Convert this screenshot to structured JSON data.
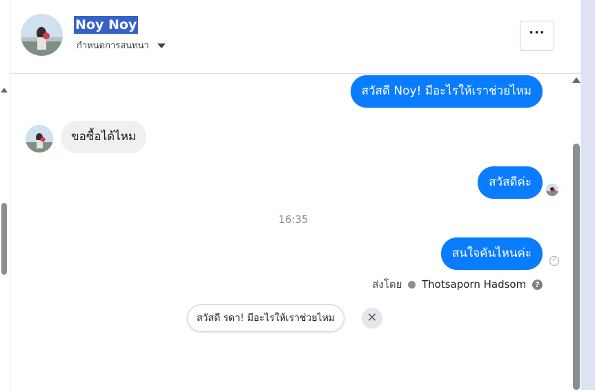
{
  "header": {
    "contact_name": "Noy Noy",
    "assign_label": "กำหนดการสนทนา",
    "more_label": "···"
  },
  "messages": {
    "out_1": "สวัสดี Noy! มีอะไรให้เราช่วยไหม",
    "in_1": "ขอซื้อได้ไหม",
    "out_2": "สวัสดีค่ะ",
    "timestamp": "16:35",
    "out_3": "สนใจคันไหนค่ะ"
  },
  "sent_by": {
    "prefix": "ส่งโดย",
    "agent": "Thotsaporn Hadsom",
    "help": "?"
  },
  "suggestion": {
    "text": "สวัสดี รดา! มีอะไรให้เราช่วยไหม",
    "dismiss": "✕"
  },
  "colors": {
    "outgoing_bubble": "#0a7cff",
    "incoming_bubble": "#f0f0f0",
    "name_highlight": "#3563c9"
  }
}
